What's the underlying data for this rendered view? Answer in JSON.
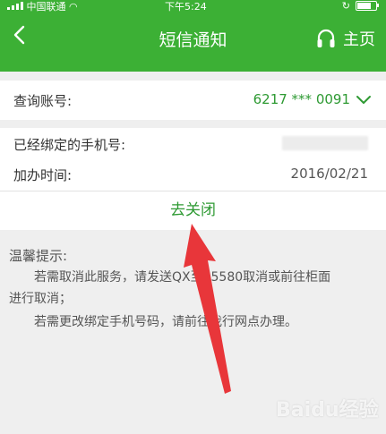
{
  "status": {
    "carrier": "中国联通",
    "time": "下午5:24"
  },
  "nav": {
    "title": "短信通知",
    "home_label": "主页"
  },
  "account": {
    "label": "查询账号:",
    "value": "6217 *** 0091"
  },
  "binding": {
    "phone_label": "已经绑定的手机号:",
    "date_label": "加办时间:",
    "date_value": "2016/02/21"
  },
  "action": {
    "close_label": "去关闭"
  },
  "tips": {
    "title": "温馨提示:",
    "line1": "若需取消此服务，请发送QX至95580取消或前往柜面",
    "line2": "进行取消；",
    "line3": "若需更改绑定手机号码，请前往我行网点办理。"
  },
  "watermark": "Baidu经验",
  "colors": {
    "brand_green": "#3cb035",
    "link_green": "#2e9a33",
    "arrow_red": "#e8363a"
  }
}
